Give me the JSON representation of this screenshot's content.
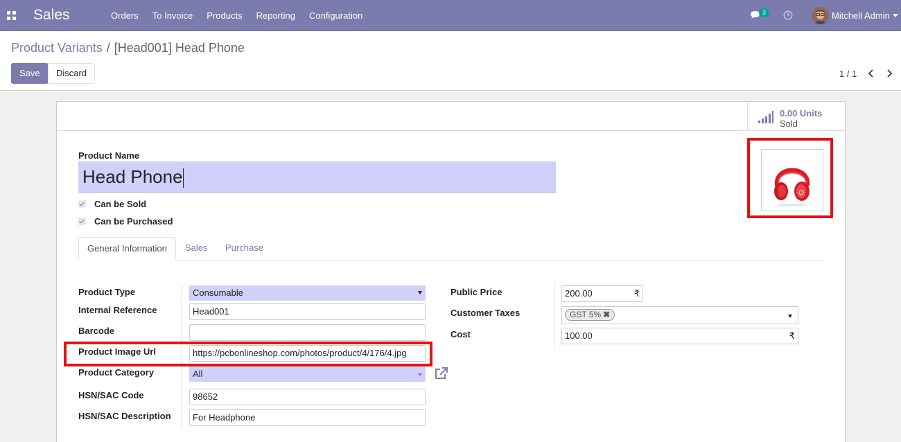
{
  "navbar": {
    "app_name": "Sales",
    "menu": [
      "Orders",
      "To Invoice",
      "Products",
      "Reporting",
      "Configuration"
    ],
    "chat_count": "3",
    "user_name": "Mitchell Admin",
    "bg_color": "#7c7bad"
  },
  "breadcrumb": {
    "parent": "Product Variants",
    "separator": "/",
    "current": "[Head001] Head Phone"
  },
  "toolbar": {
    "save_label": "Save",
    "discard_label": "Discard",
    "pager": "1 / 1"
  },
  "stat": {
    "value": "0.00 Units",
    "label": "Sold"
  },
  "form": {
    "product_name_label": "Product Name",
    "product_name": "Head Phone",
    "can_be_sold": "Can be Sold",
    "can_be_purchased": "Can be Purchased",
    "tabs": [
      "General Information",
      "Sales",
      "Purchase"
    ],
    "left_fields": {
      "product_type_label": "Product Type",
      "product_type": "Consumable",
      "internal_reference_label": "Internal Reference",
      "internal_reference": "Head001",
      "barcode_label": "Barcode",
      "barcode": "",
      "image_url_label": "Product Image Url",
      "image_url": "https://pcbonlineshop.com/photos/product/4/176/4.jpg",
      "category_label": "Product Category",
      "category": "All",
      "hsn_code_label": "HSN/SAC Code",
      "hsn_code": "98652",
      "hsn_desc_label": "HSN/SAC Description",
      "hsn_desc": "For Headphone"
    },
    "right_fields": {
      "public_price_label": "Public Price",
      "public_price": "200.00",
      "currency": "₹",
      "customer_taxes_label": "Customer Taxes",
      "tax_tag": "GST 5%",
      "tax_remove": "✖",
      "cost_label": "Cost",
      "cost": "100.00"
    }
  },
  "icons": {
    "apps": "apps-grid-icon",
    "chat": "chat-icon",
    "clock": "clock-icon",
    "stat": "signal-bars-icon",
    "external": "external-link-icon",
    "product_image": "red-headphones-image"
  },
  "colors": {
    "accent": "#7c7bad",
    "highlight": "#e41313",
    "input_required": "#d0d0fa"
  }
}
